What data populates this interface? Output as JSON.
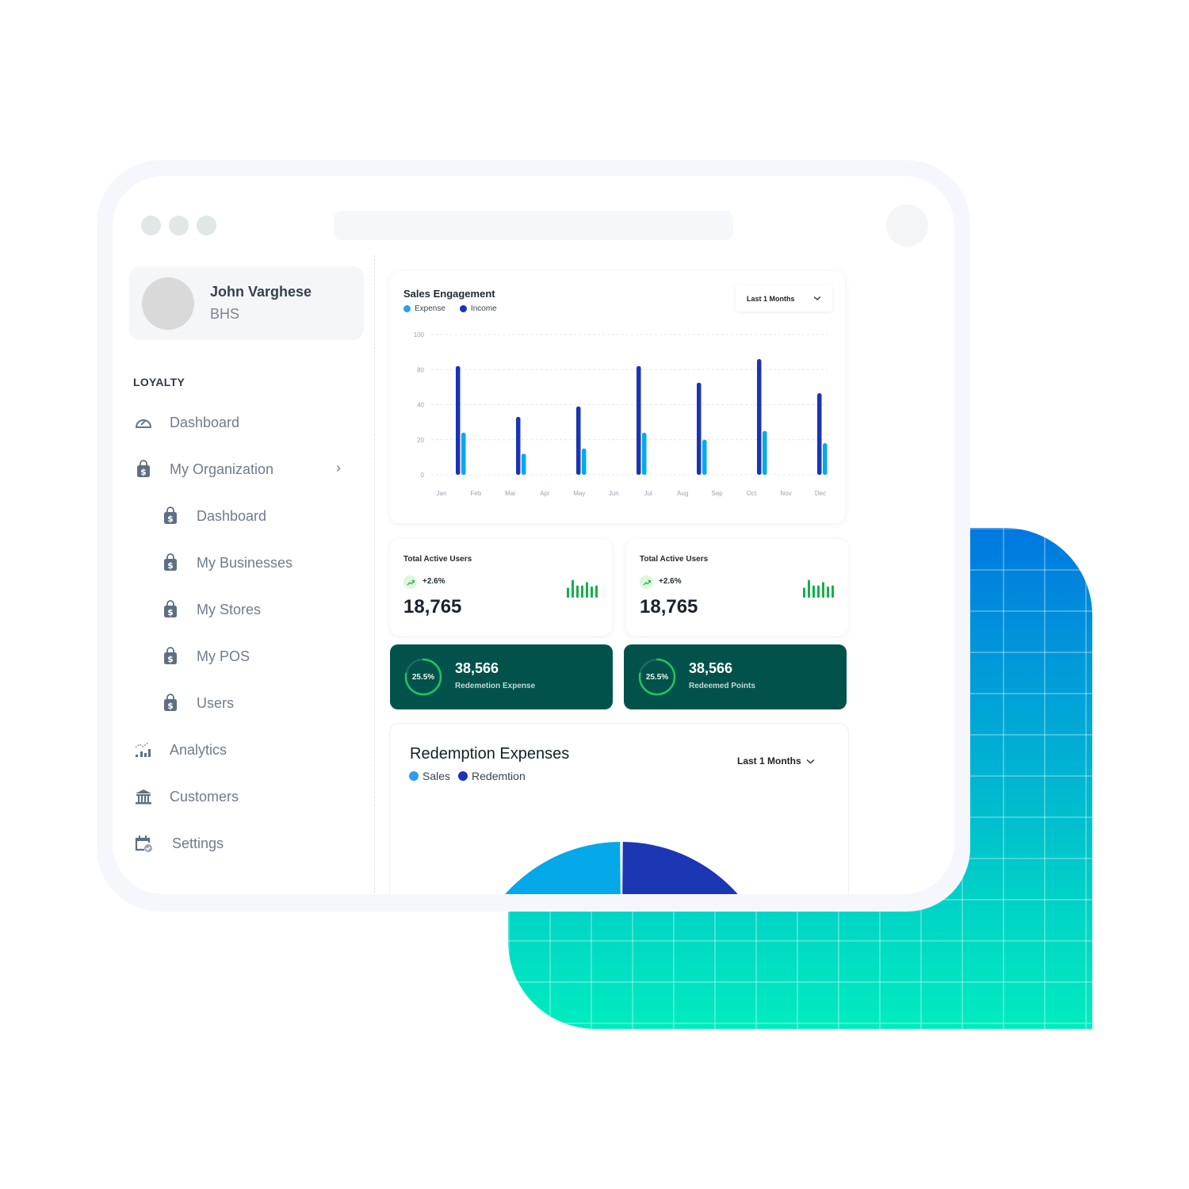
{
  "window": {
    "traffic_dots": 3
  },
  "sidebar": {
    "profile": {
      "name": "John Varghese",
      "org": "BHS"
    },
    "section_heading": "LOYALTY",
    "items": [
      {
        "label": "Dashboard",
        "icon": "gauge-icon",
        "level": 0
      },
      {
        "label": "My Organization",
        "icon": "shopping-bag-dollar-icon",
        "level": 0,
        "chevron": "›"
      },
      {
        "label": "Dashboard",
        "icon": "shopping-bag-dollar-icon",
        "level": 1
      },
      {
        "label": "My Businesses",
        "icon": "shopping-bag-dollar-icon",
        "level": 1
      },
      {
        "label": "My Stores",
        "icon": "shopping-bag-dollar-icon",
        "level": 1
      },
      {
        "label": "My POS",
        "icon": "shopping-bag-dollar-icon",
        "level": 1
      },
      {
        "label": "Users",
        "icon": "shopping-bag-dollar-icon",
        "level": 1
      },
      {
        "label": "Analytics",
        "icon": "analytics-icon",
        "level": 0
      },
      {
        "label": "Customers",
        "icon": "bank-icon",
        "level": 0
      },
      {
        "label": "Settings",
        "icon": "calendar-check-icon",
        "level": 0
      }
    ]
  },
  "sales_engagement": {
    "title": "Sales Engagement",
    "dropdown": "Last 1 Months",
    "legend": [
      {
        "name": "Expense",
        "color": "#2d9cf5"
      },
      {
        "name": "Income",
        "color": "#1b34b4"
      }
    ]
  },
  "stats": [
    {
      "title": "Total Active Users",
      "trend": "+2.6%",
      "value": "18,765",
      "spark": [
        0.45,
        0.8,
        0.55,
        0.55,
        0.7,
        0.5,
        0.55
      ]
    },
    {
      "title": "Total Active Users",
      "trend": "+2.6%",
      "value": "18,765",
      "spark": [
        0.45,
        0.8,
        0.55,
        0.55,
        0.7,
        0.5,
        0.55
      ]
    }
  ],
  "highlights": [
    {
      "ring_label": "25.5%",
      "ring_fill": 0.78,
      "value": "38,566",
      "label": "Redemetion Expense"
    },
    {
      "ring_label": "25.5%",
      "ring_fill": 0.78,
      "value": "38,566",
      "label": "Redeemed Points"
    }
  ],
  "redemption_expenses": {
    "title": "Redemption Expenses",
    "dropdown": "Last 1 Months",
    "legend": [
      {
        "name": "Sales",
        "color": "#2d9cf5"
      },
      {
        "name": "Redemtion",
        "color": "#1b34b4"
      }
    ]
  },
  "colors": {
    "income": "#1b34b4",
    "expense": "#03a9ea",
    "green_card": "#00524a",
    "ring": "#22c35e",
    "spark": "#12b04a",
    "donut_sales": "#05a8e8",
    "donut_redemption": "#1b37b3"
  },
  "chart_data": [
    {
      "type": "bar",
      "title": "Sales Engagement",
      "xlabel": "",
      "ylabel": "",
      "x_tick_labels": [
        "Jan",
        "Feb",
        "Mar",
        "Apr",
        "May",
        "Jun",
        "Jul",
        "Aug",
        "Sep",
        "Oct",
        "Nov",
        "Dec"
      ],
      "y_tick_labels": [
        "0",
        "20",
        "40",
        "80",
        "100"
      ],
      "ylim": [
        0,
        100
      ],
      "grid": true,
      "legend_position": "top-left",
      "categories": [
        "Jan",
        "Mar",
        "May",
        "Jul",
        "Sep",
        "Oct",
        "Dec"
      ],
      "series": [
        {
          "name": "Income",
          "values": [
            82,
            33,
            39,
            82,
            65,
            86,
            53
          ]
        },
        {
          "name": "Expense",
          "values": [
            24,
            12,
            15,
            24,
            20,
            25,
            18
          ]
        }
      ]
    },
    {
      "type": "pie",
      "title": "Redemption Expenses",
      "style": "donut (top half visible, clipped)",
      "legend_position": "top-left",
      "categories": [
        "Sales",
        "Redemtion"
      ],
      "values": [
        50,
        50
      ]
    }
  ]
}
